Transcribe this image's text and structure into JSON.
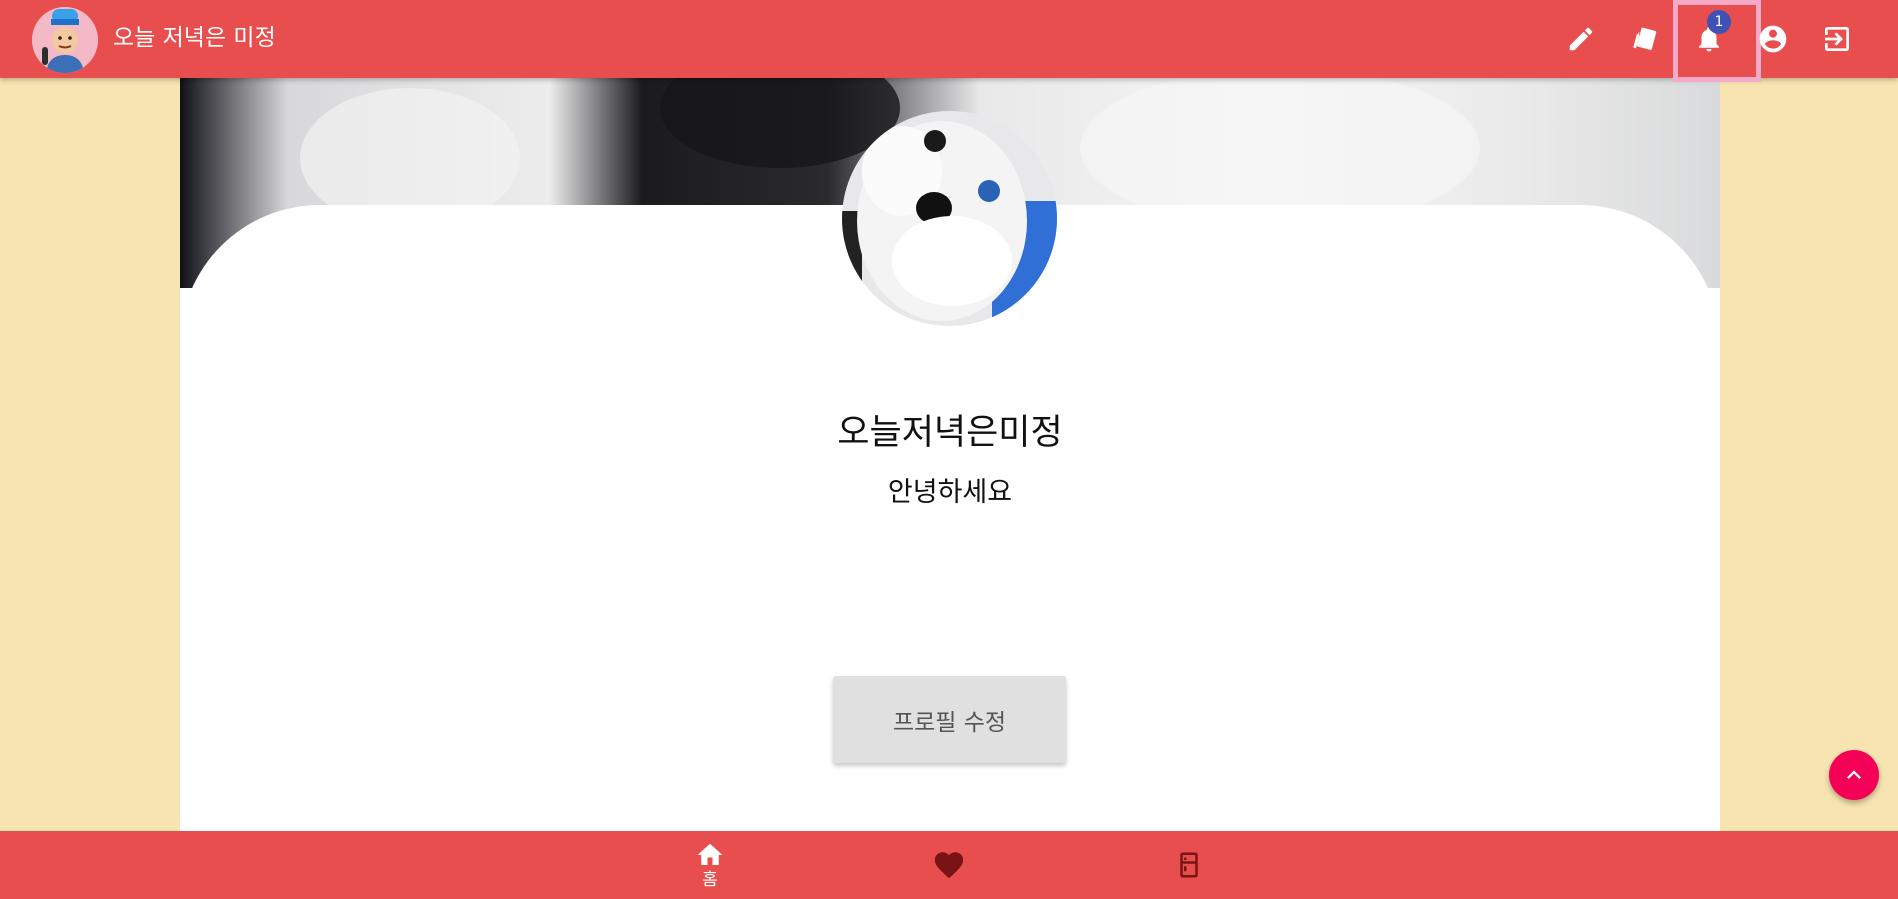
{
  "header": {
    "app_title": "오늘 저녁은 미정",
    "notification_count": "1",
    "actions": [
      {
        "icon": "pencil-icon",
        "name": "write"
      },
      {
        "icon": "cards-icon",
        "name": "recipes"
      },
      {
        "icon": "bell-icon",
        "name": "notifications"
      },
      {
        "icon": "account-circle-icon",
        "name": "profile"
      },
      {
        "icon": "logout-icon",
        "name": "logout"
      }
    ]
  },
  "profile": {
    "nickname": "오늘저녁은미정",
    "bio": "안녕하세요",
    "edit_button_label": "프로필 수정"
  },
  "bottom_nav": {
    "home_label": "홈",
    "items": [
      {
        "icon": "home-icon",
        "label": "홈"
      },
      {
        "icon": "heart-icon",
        "label": ""
      },
      {
        "icon": "fridge-icon",
        "label": ""
      }
    ]
  },
  "colors": {
    "primary": "#e94e4e",
    "page_background": "#f8e4b0",
    "fab": "#f50057",
    "badge": "#3f51b5",
    "highlight": "#f7a9c8"
  }
}
